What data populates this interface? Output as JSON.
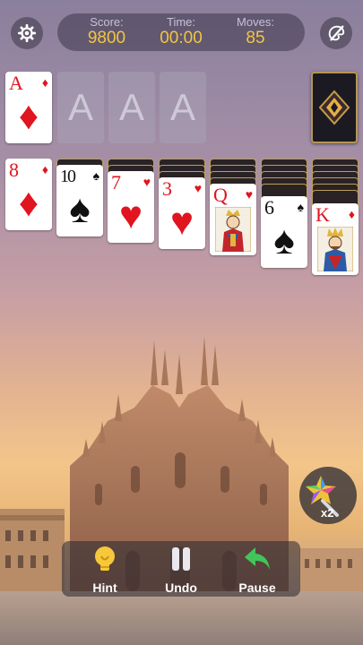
{
  "stats": {
    "score_label": "Score:",
    "score_value": "9800",
    "time_label": "Time:",
    "time_value": "00:00",
    "moves_label": "Moves:",
    "moves_value": "85"
  },
  "top_icons": {
    "left": "settings-gear-icon",
    "right": "theme-brush-icon"
  },
  "foundations": [
    {
      "rank": "A",
      "suit": "♦",
      "color": "#e0151f",
      "filled": true
    },
    {
      "rank": "A",
      "filled": false
    },
    {
      "rank": "A",
      "filled": false
    },
    {
      "rank": "A",
      "filled": false
    }
  ],
  "tableau": [
    {
      "rank": "8",
      "suit": "♦",
      "color": "red"
    },
    {
      "rank": "10",
      "suit": "♠",
      "color": "black"
    },
    {
      "rank": "7",
      "suit": "♥",
      "color": "red"
    },
    {
      "rank": "3",
      "suit": "♥",
      "color": "red"
    },
    {
      "rank": "Q",
      "suit": "♥",
      "color": "red",
      "face": "queen"
    },
    {
      "rank": "6",
      "suit": "♠",
      "color": "black"
    },
    {
      "rank": "K",
      "suit": "♦",
      "color": "red",
      "face": "king"
    }
  ],
  "toolbar": {
    "hint": "Hint",
    "undo": "Undo",
    "pause": "Pause"
  },
  "magic": {
    "label": "x2"
  }
}
